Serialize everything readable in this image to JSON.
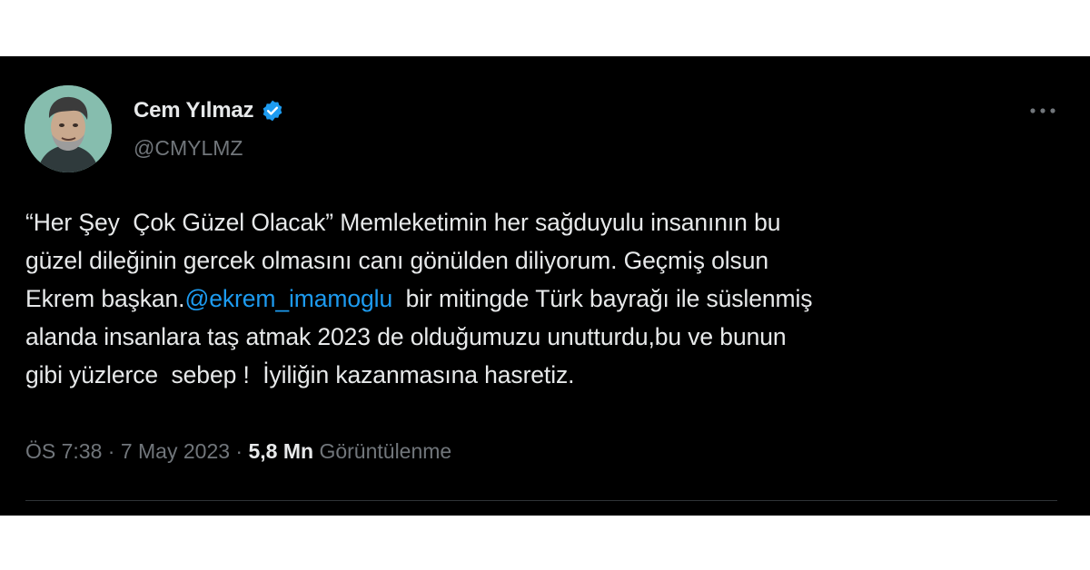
{
  "tweet": {
    "author": {
      "display_name": "Cem Yılmaz",
      "handle": "@CMYLMZ",
      "verified_icon": "verified-badge-icon",
      "avatar": "profile-photo"
    },
    "more_icon": "more-horizontal-icon",
    "text": {
      "part1": "“Her Şey  Çok Güzel Olacak” Memleketimin her sağduyulu insanının bu\ngüzel dileğinin gercek olmasını canı gönülden diliyorum. Geçmiş olsun\nEkrem başkan.",
      "mention": "@ekrem_imamoglu",
      "part2": "  bir mitingde Türk bayrağı ile süslenmiş\nalanda insanlara taş atmak 2023 de olduğumuzu unutturdu,bu ve bunun\ngibi yüzlerce  sebep !  İyiliğin kazanmasına hasretiz."
    },
    "meta": {
      "time": "ÖS 7:38",
      "separator": " · ",
      "date": "7 May 2023",
      "views_count": "5,8 Mn",
      "views_label": "Görüntülenme"
    }
  },
  "colors": {
    "background": "#000000",
    "text": "#e7e9ea",
    "secondary": "#71767b",
    "accent": "#1d9bf0"
  }
}
